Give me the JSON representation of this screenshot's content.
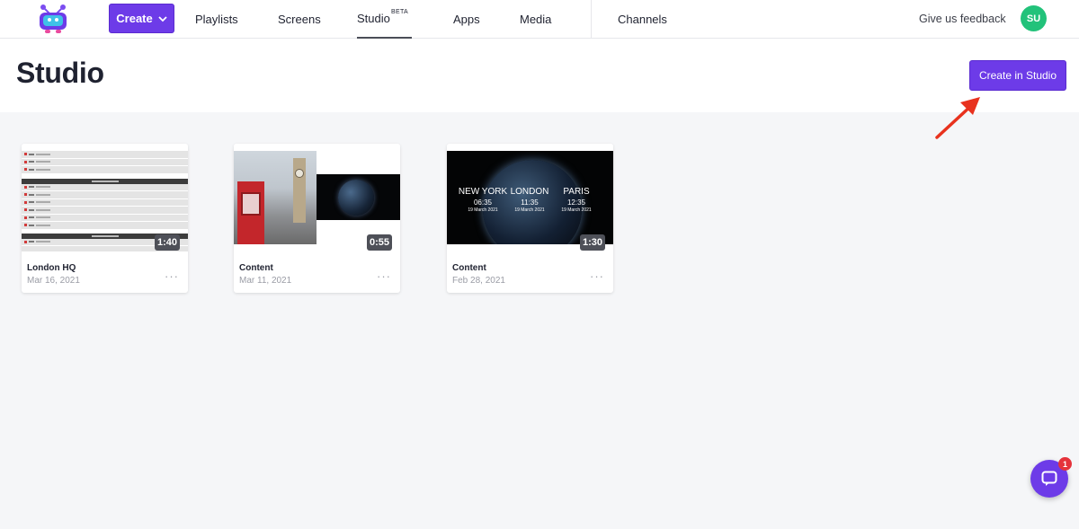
{
  "nav": {
    "create_label": "Create",
    "items": [
      {
        "label": "Playlists"
      },
      {
        "label": "Screens"
      },
      {
        "label": "Studio",
        "badge": "BETA",
        "active": true
      },
      {
        "label": "Apps"
      },
      {
        "label": "Media"
      },
      {
        "label": "Channels"
      }
    ],
    "feedback_label": "Give us feedback",
    "avatar_initials": "SU"
  },
  "page": {
    "title": "Studio",
    "create_in_studio_label": "Create in Studio"
  },
  "cards": [
    {
      "title": "London HQ",
      "date": "Mar 16, 2021",
      "duration": "1:40"
    },
    {
      "title": "Content",
      "date": "Mar 11, 2021",
      "duration": "0:55"
    },
    {
      "title": "Content",
      "date": "Feb 28, 2021",
      "duration": "1:30"
    }
  ],
  "world_clock": [
    {
      "city": "NEW YORK",
      "time": "06:35",
      "date": "19 March 2021"
    },
    {
      "city": "LONDON",
      "time": "11:35",
      "date": "19 March 2021"
    },
    {
      "city": "PARIS",
      "time": "12:35",
      "date": "19 March 2021"
    }
  ],
  "more_label": "···",
  "chat": {
    "unread_count": "1"
  },
  "colors": {
    "accent": "#6d3be8",
    "avatar": "#22c27a",
    "badge": "#e5333b",
    "annotation_arrow": "#e8321e"
  }
}
